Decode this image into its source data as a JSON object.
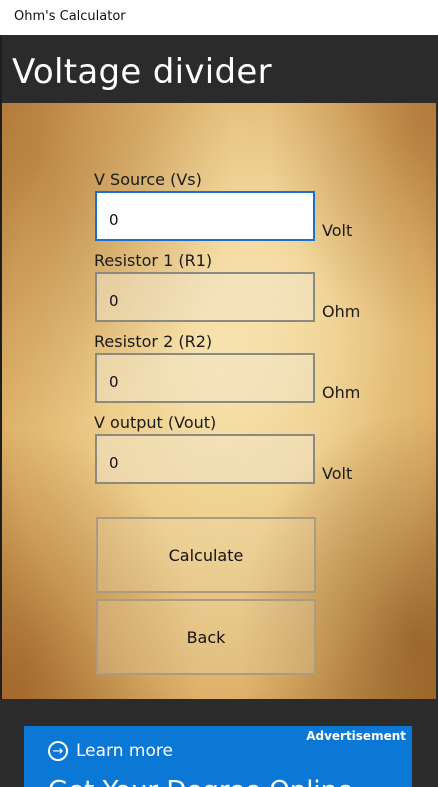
{
  "window": {
    "title": "Ohm's Calculator"
  },
  "page": {
    "heading": "Voltage divider"
  },
  "form": {
    "vs_label": "V Source  (Vs)",
    "vs_value": "0",
    "vs_unit": "Volt",
    "r1_label": "Resistor 1 (R1)",
    "r1_value": "0",
    "r1_unit": "Ohm",
    "r2_label": "Resistor 2 (R2)",
    "r2_value": "0",
    "r2_unit": "Ohm",
    "vout_label": "V output (Vout)",
    "vout_value": "0",
    "vout_unit": "Volt"
  },
  "buttons": {
    "calculate": "Calculate",
    "back": "Back"
  },
  "ad": {
    "badge": "Advertisement",
    "learn_more": "Learn more",
    "headline": "Get Your Degree Online"
  },
  "colors": {
    "accent": "#1c6fd0",
    "ad_blue": "#0a78d4",
    "header": "#2b2b2b"
  }
}
